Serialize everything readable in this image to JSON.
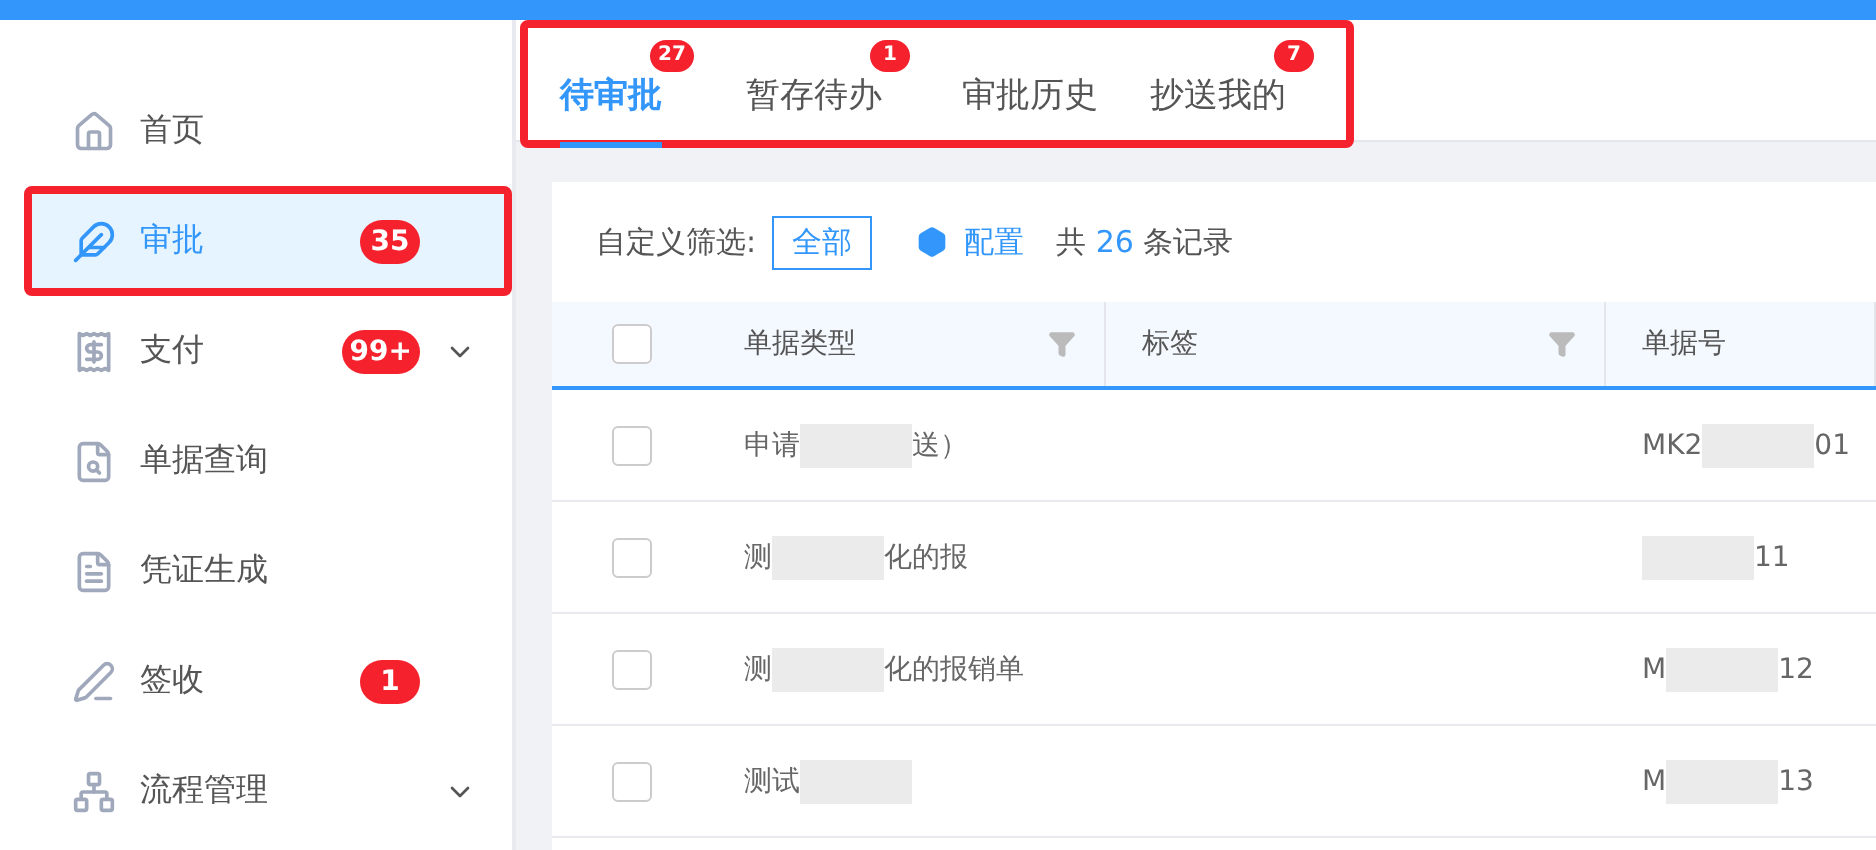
{
  "sidebar": {
    "items": [
      {
        "label": "首页",
        "selected": false,
        "highlighted": false
      },
      {
        "label": "审批",
        "selected": true,
        "highlighted": true,
        "badge": "35"
      },
      {
        "label": "支付",
        "selected": false,
        "highlighted": false,
        "badge": "99+",
        "expandable": true
      },
      {
        "label": "单据查询",
        "selected": false,
        "highlighted": false
      },
      {
        "label": "凭证生成",
        "selected": false,
        "highlighted": false
      },
      {
        "label": "签收",
        "selected": false,
        "highlighted": false,
        "badge": "1"
      },
      {
        "label": "流程管理",
        "selected": false,
        "highlighted": false,
        "expandable": true
      }
    ]
  },
  "tabs": {
    "highlighted": true,
    "items": [
      {
        "label": "待审批",
        "selected": true,
        "badge": "27"
      },
      {
        "label": "暂存待办",
        "selected": false,
        "badge": "1"
      },
      {
        "label": "审批历史",
        "selected": false
      },
      {
        "label": "抄送我的",
        "selected": false,
        "badge": "7"
      }
    ]
  },
  "filter": {
    "label": "自定义筛选:",
    "option": "全部",
    "config": "配置",
    "count_prefix": "共",
    "count": "26",
    "count_suffix": "条记录"
  },
  "table": {
    "header_checked": false,
    "columns": [
      {
        "label": "单据类型",
        "filter": true
      },
      {
        "label": "标签",
        "filter": true
      },
      {
        "label": "单据号",
        "filter": false
      }
    ],
    "rows": [
      {
        "checked": false,
        "type_start": "申请",
        "type_end": "送）",
        "number_start": "MK2",
        "number_end": "01"
      },
      {
        "checked": false,
        "type_start": "测",
        "type_end": "化的报",
        "number_end": "11"
      },
      {
        "checked": false,
        "type_start": "测",
        "type_end": "化的报销单",
        "number_start": "M",
        "number_end": "12"
      },
      {
        "checked": false,
        "type_start": "测试",
        "number_start": "M",
        "number_end": "13"
      }
    ]
  }
}
